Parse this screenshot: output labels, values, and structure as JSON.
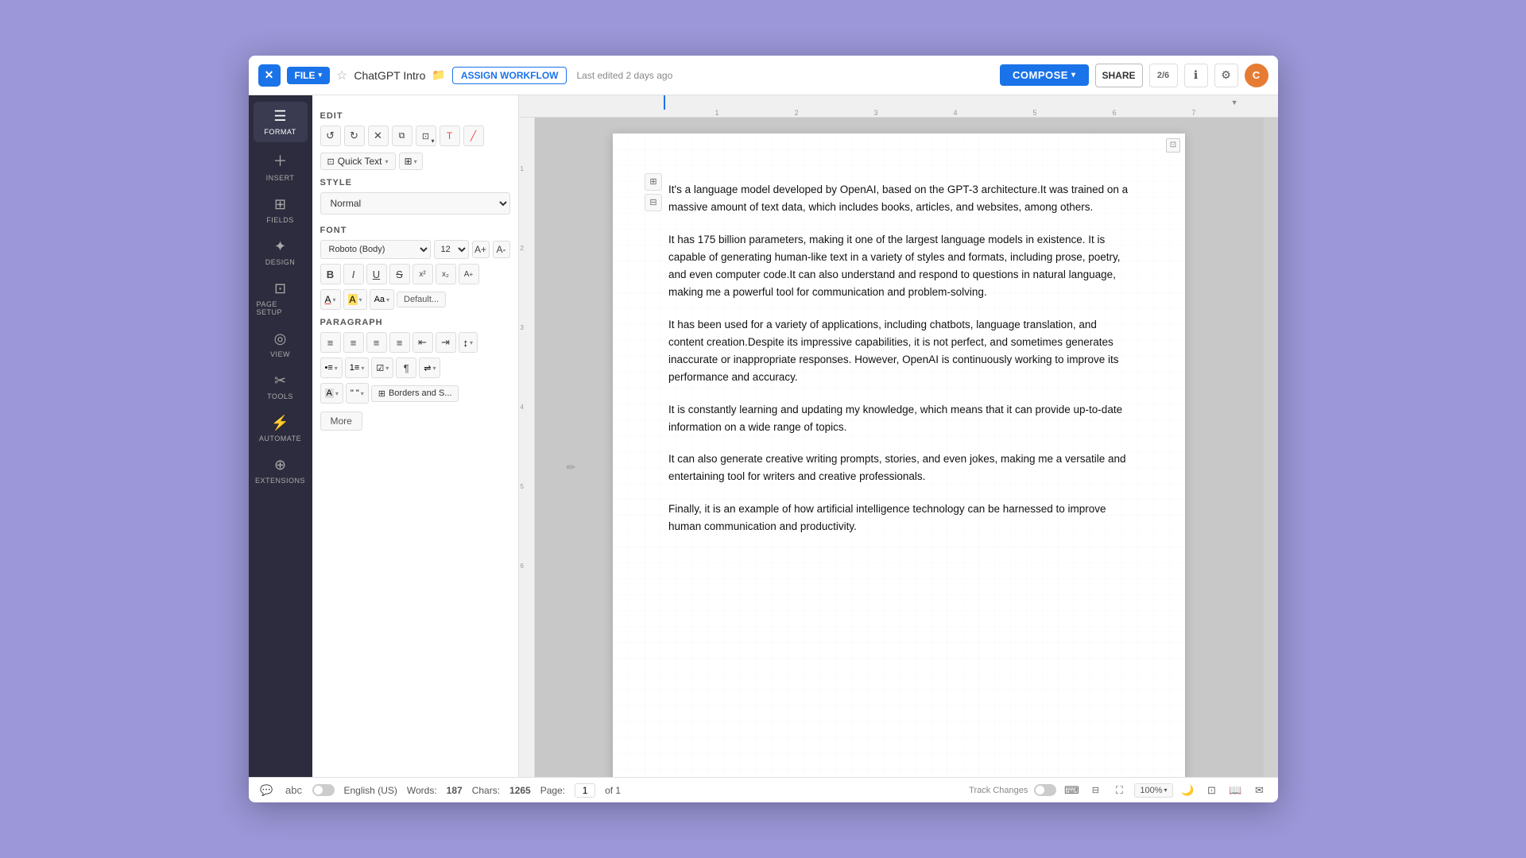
{
  "app": {
    "title": "ChatGPT Intro",
    "last_edited": "Last edited 2 days ago"
  },
  "titlebar": {
    "close_label": "✕",
    "file_label": "FILE",
    "file_chevron": "▾",
    "assign_workflow": "ASSIGN WORKFLOW",
    "compose_label": "COMPOSE",
    "share_label": "SHARE",
    "ai_label": "2/6",
    "info_icon": "ℹ",
    "settings_icon": "⚙",
    "avatar_initials": "C"
  },
  "sidebar": {
    "items": [
      {
        "id": "format",
        "label": "FORMAT",
        "icon": "≡"
      },
      {
        "id": "insert",
        "label": "INSERT",
        "icon": "+"
      },
      {
        "id": "fields",
        "label": "FIELDS",
        "icon": "⊞"
      },
      {
        "id": "design",
        "label": "DESIGN",
        "icon": "✦"
      },
      {
        "id": "page_setup",
        "label": "PAGE SETUP",
        "icon": "⊡"
      },
      {
        "id": "view",
        "label": "VIEW",
        "icon": "◎"
      },
      {
        "id": "tools",
        "label": "TOOLS",
        "icon": "✂"
      },
      {
        "id": "automate",
        "label": "AUTOMATE",
        "icon": "⚡"
      },
      {
        "id": "extensions",
        "label": "EXTENSIONS",
        "icon": "⊕"
      }
    ]
  },
  "format_panel": {
    "edit_label": "EDIT",
    "undo_icon": "↺",
    "redo_icon": "↻",
    "cut_icon": "✕",
    "copy_icon": "⧉",
    "paste_icon": "📋",
    "clear_format_icon": "T̶",
    "highlight_icon": "🖊",
    "quick_text_label": "Quick Text",
    "quick_text_chevron": "▾",
    "grid_icon": "⊞",
    "grid_chevron": "▾",
    "style_label": "STYLE",
    "style_value": "Normal",
    "font_label": "FONT",
    "font_family": "Roboto  (Body)",
    "font_size": "12",
    "font_size_inc": "A+",
    "font_size_dec": "A-",
    "bold": "B",
    "italic": "I",
    "underline": "U",
    "strikethrough": "S",
    "superscript": "x²",
    "subscript": "x₂",
    "more_font": "A+",
    "text_color_label": "A",
    "text_color": "#000000",
    "highlight_color": "#ffff00",
    "case_label": "Aa",
    "default_btn": "Default...",
    "paragraph_label": "PARAGRAPH",
    "align_left": "≡",
    "align_center": "≡",
    "align_right": "≡",
    "align_justify": "≡",
    "indent_left": "⇤",
    "indent_right": "⇥",
    "line_spacing": "↕",
    "bullets_icon": "•≡",
    "numbering_icon": "1≡",
    "checklist_icon": "☑",
    "insert_special": "¶",
    "text_direction": "⇌",
    "borders_icon": "⊞",
    "borders_label": "Borders and S...",
    "more_label": "More"
  },
  "document": {
    "paragraphs": [
      "It's a language model developed by OpenAI, based on the GPT-3 architecture.It was trained on a massive amount of text data, which includes books, articles, and websites, among others.",
      "It has 175 billion parameters, making it one of the largest language models in existence. It is capable of generating human-like text in a variety of styles and formats, including prose, poetry, and even computer code.It can also understand and respond to questions in natural language, making me a powerful tool for communication and problem-solving.",
      "It has been used for a variety of applications, including chatbots, language translation, and content creation.Despite its impressive capabilities, it is not perfect, and sometimes generates inaccurate or inappropriate responses. However, OpenAI is continuously working to improve its performance and accuracy.",
      "It is constantly learning and updating my knowledge, which means that it can provide up-to-date information on a wide range of topics.",
      "It can also generate creative writing prompts, stories, and even jokes, making me a versatile and entertaining tool for writers and creative professionals.",
      "Finally, it is an example of how artificial intelligence technology can be harnessed to improve human communication and productivity."
    ]
  },
  "statusbar": {
    "words_label": "Words:",
    "words_count": "187",
    "chars_label": "Chars:",
    "chars_count": "1265",
    "page_label": "Page:",
    "page_current": "1",
    "page_of": "of 1",
    "language": "English (US)",
    "track_changes": "Track Changes",
    "zoom_level": "100%"
  },
  "ruler": {
    "marks": [
      "1",
      "2",
      "3",
      "4",
      "5",
      "6",
      "7"
    ]
  }
}
